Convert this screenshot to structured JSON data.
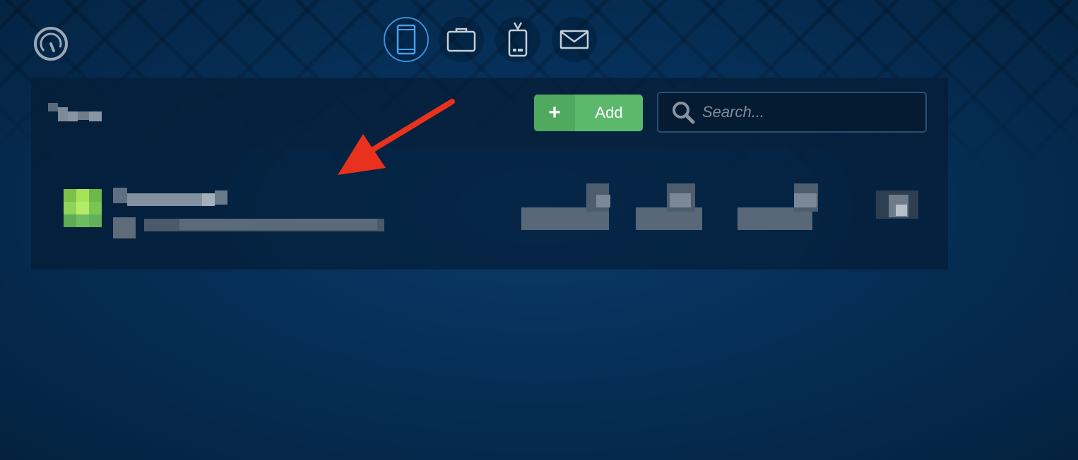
{
  "top_nav": {
    "dashboard_icon": "speedometer-icon",
    "tabs": [
      {
        "icon": "tablet-icon",
        "active": true
      },
      {
        "icon": "briefcase-icon",
        "active": false
      },
      {
        "icon": "id-badge-icon",
        "active": false
      },
      {
        "icon": "envelope-icon",
        "active": false
      }
    ]
  },
  "toolbar": {
    "add_label": "Add",
    "add_icon": "plus-icon",
    "search_placeholder": "Search..."
  },
  "colors": {
    "background": "#062f57",
    "accent_active_tab": "#3f8fd6",
    "add_button": "#5cb96c",
    "annotation_arrow": "#e8321e",
    "avatar": "#8fd35a"
  },
  "annotation": {
    "type": "arrow",
    "points_to": "list-item"
  }
}
